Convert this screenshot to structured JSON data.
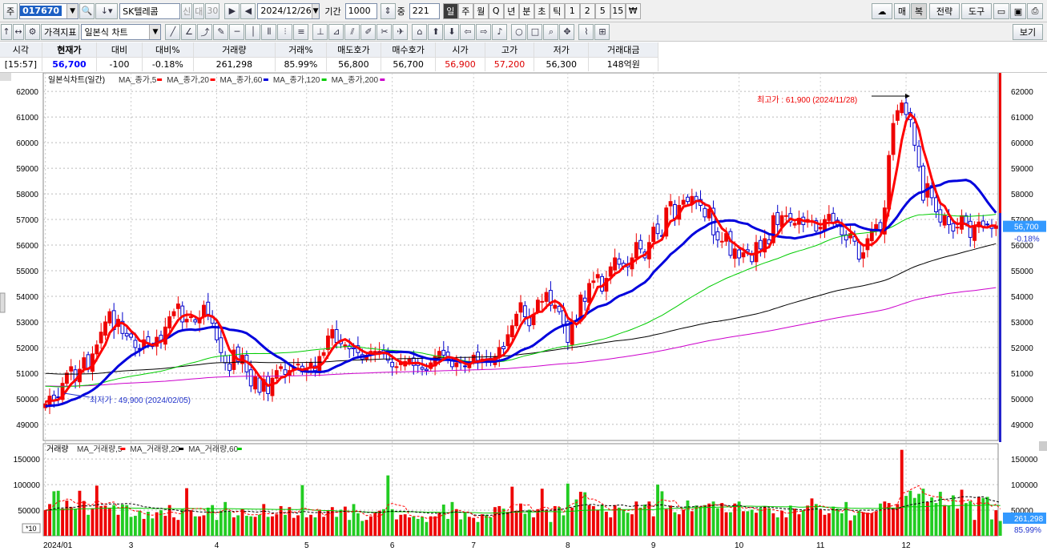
{
  "toolbar": {
    "mode_label": "주",
    "stock_code": "017670",
    "stock_name": "SK텔레콤",
    "market_btns": [
      "신",
      "대",
      "30"
    ],
    "date": "2024/12/26",
    "period_label": "기간",
    "period_value": "1000",
    "count_label": "중",
    "count_value": "221",
    "timeframes": [
      "일",
      "주",
      "월",
      "Q",
      "년",
      "분",
      "초",
      "틱",
      "1",
      "2",
      "5",
      "15",
      "₩"
    ],
    "active_timeframe": "일",
    "right_buttons": [
      "매",
      "복",
      "전략",
      "도구"
    ]
  },
  "toolbar2": {
    "indicator_btn": "가격지표",
    "chart_type": "일본식 차트",
    "view_btn": "보기"
  },
  "quote": {
    "headers": [
      "시각",
      "현재가",
      "대비",
      "대비%",
      "거래량",
      "거래%",
      "매도호가",
      "매수호가",
      "시가",
      "고가",
      "저가",
      "거래대금"
    ],
    "values": [
      "[15:57]",
      "56,700",
      "-100",
      "-0.18%",
      "261,298",
      "85.99%",
      "56,800",
      "56,700",
      "56,900",
      "57,200",
      "56,300",
      "148억원"
    ]
  },
  "chart_data": [
    {
      "type": "candlestick",
      "title": "일본식차트(일간)",
      "legend": [
        {
          "name": "MA_종가,5",
          "color": "#ff0000"
        },
        {
          "name": "MA_종가,20",
          "color": "#ff0000"
        },
        {
          "name": "MA_종가,60",
          "color": "#0000dd"
        },
        {
          "name": "MA_종가,120",
          "color": "#00cc00"
        },
        {
          "name": "MA_종가,200",
          "color": "#cc00cc"
        }
      ],
      "ylim": [
        48400,
        62600
      ],
      "y_ticks": [
        49000,
        50000,
        51000,
        52000,
        53000,
        54000,
        55000,
        56000,
        57000,
        58000,
        59000,
        60000,
        61000,
        62000
      ],
      "x_ticks": [
        "2024/01",
        "3",
        "4",
        "5",
        "6",
        "7",
        "8",
        "9",
        "10",
        "11",
        "12"
      ],
      "x_tick_index": [
        0,
        20,
        40,
        61,
        81,
        100,
        122,
        142,
        162,
        181,
        201
      ],
      "closes": [
        49800,
        50100,
        49950,
        50050,
        50600,
        51000,
        51250,
        50700,
        51150,
        51600,
        51150,
        51750,
        52100,
        52600,
        53000,
        53400,
        52700,
        53100,
        52550,
        52450,
        52400,
        52000,
        51950,
        52300,
        52150,
        52050,
        52400,
        52250,
        52800,
        53200,
        53400,
        53700,
        53000,
        53100,
        53200,
        53000,
        53150,
        53650,
        53300,
        52950,
        52300,
        51800,
        51400,
        51100,
        51900,
        51450,
        51700,
        51050,
        50500,
        50850,
        50250,
        50750,
        50200,
        50800,
        51100,
        51250,
        50950,
        51100,
        51200,
        51350,
        51050,
        51150,
        51400,
        51100,
        51650,
        51800,
        52450,
        52700,
        52200,
        52150,
        52100,
        51950,
        51950,
        51800,
        51550,
        51700,
        51850,
        51850,
        51850,
        51750,
        51500,
        51250,
        51250,
        51400,
        51450,
        51550,
        51300,
        51300,
        51150,
        51100,
        51400,
        51650,
        51850,
        51700,
        51550,
        51250,
        51400,
        51400,
        51250,
        51400,
        51700,
        51500,
        51550,
        51500,
        51450,
        51650,
        52000,
        51950,
        52500,
        52850,
        53300,
        53750,
        53200,
        52850,
        53300,
        53850,
        53800,
        54150,
        53650,
        53650,
        53400,
        52900,
        52200,
        53050,
        52950,
        54050,
        53800,
        54500,
        54600,
        54850,
        54200,
        54700,
        55150,
        55500,
        55250,
        55150,
        55150,
        55500,
        56100,
        55850,
        55500,
        56100,
        56700,
        56450,
        56350,
        57450,
        57700,
        57050,
        57550,
        57750,
        57700,
        57900,
        57700,
        57550,
        57100,
        57400,
        56400,
        56200,
        56150,
        56450,
        55600,
        55850,
        55500,
        55700,
        55750,
        55350,
        56100,
        55850,
        56250,
        56050,
        57150,
        56800,
        57150,
        57150,
        56900,
        56850,
        57050,
        56800,
        57000,
        56950,
        56550,
        56700,
        57000,
        57200,
        56850,
        56800,
        56400,
        56200,
        56450,
        56150,
        55450,
        55700,
        56250,
        56550,
        56800,
        56550,
        57450,
        59500,
        60750,
        61250,
        61550,
        61100,
        60900,
        59900,
        59050,
        57750,
        58400,
        57850,
        57300,
        56900,
        57150,
        56800,
        56550,
        56700,
        57150,
        56850,
        56300,
        56750,
        56900,
        56700,
        56800,
        56650,
        56750
      ]
    },
    {
      "type": "bar",
      "title": "거래량",
      "legend": [
        {
          "name": "MA_거래량,5",
          "color": "#ff0000"
        },
        {
          "name": "MA_거래량,20",
          "color": "#000000"
        },
        {
          "name": "MA_거래량,60",
          "color": "#00cc00"
        }
      ],
      "ylim": [
        0,
        180000
      ],
      "y_ticks": [
        50000,
        100000,
        150000
      ],
      "y_tick_labels": [
        "50000",
        "100000",
        "150000"
      ],
      "unit_badge": "*10",
      "last_volume": "261,298",
      "last_ratio": "85.99%",
      "values": [
        50000,
        62000,
        87000,
        88000,
        53000,
        69000,
        56000,
        53000,
        88000,
        68000,
        41000,
        54000,
        98000,
        58000,
        59000,
        55000,
        60000,
        41000,
        61000,
        60000,
        37000,
        39000,
        49000,
        33000,
        47000,
        34000,
        46000,
        50000,
        39000,
        60000,
        36000,
        31000,
        52000,
        93000,
        50000,
        38000,
        38000,
        40000,
        55000,
        60000,
        31000,
        49000,
        66000,
        47000,
        36000,
        40000,
        52000,
        39000,
        38000,
        37000,
        41000,
        62000,
        37000,
        38000,
        42000,
        58000,
        41000,
        56000,
        35000,
        40000,
        99000,
        36000,
        41000,
        36000,
        49000,
        37000,
        50000,
        56000,
        37000,
        51000,
        57000,
        31000,
        62000,
        44000,
        29000,
        31000,
        38000,
        45000,
        49000,
        52000,
        118000,
        52000,
        32000,
        41000,
        42000,
        36000,
        38000,
        33000,
        37000,
        27000,
        38000,
        38000,
        45000,
        61000,
        33000,
        66000,
        52000,
        32000,
        46000,
        37000,
        35000,
        27000,
        42000,
        41000,
        36000,
        56000,
        58000,
        53000,
        47000,
        96000,
        49000,
        63000,
        43000,
        51000,
        36000,
        52000,
        92000,
        50000,
        27000,
        58000,
        56000,
        40000,
        102000,
        55000,
        71000,
        86000,
        85000,
        60000,
        58000,
        51000,
        61000,
        47000,
        36000,
        60000,
        55000,
        51000,
        45000,
        42000,
        67000,
        55000,
        61000,
        67000,
        38000,
        100000,
        87000,
        52000,
        59000,
        46000,
        42000,
        51000,
        69000,
        48000,
        59000,
        57000,
        60000,
        63000,
        67000,
        54000,
        64000,
        46000,
        46000,
        63000,
        67000,
        48000,
        48000,
        51000,
        45000,
        54000,
        58000,
        54000,
        44000,
        36000,
        49000,
        36000,
        59000,
        53000,
        42000,
        50000,
        59000,
        73000,
        62000,
        51000,
        41000,
        44000,
        57000,
        53000,
        44000,
        66000,
        30000,
        40000,
        49000,
        46000,
        45000,
        44000,
        48000,
        63000,
        67000,
        64000,
        54000,
        62000,
        168000,
        78000,
        88000,
        74000,
        82000,
        92000,
        66000,
        75000,
        64000,
        86000,
        60000,
        58000,
        79000,
        53000,
        90000,
        64000,
        68000,
        31000,
        76000,
        74000,
        76000,
        32000,
        50000,
        29000
      ]
    }
  ],
  "annotations": {
    "high": "최고가 : 61,900 (2024/11/28)",
    "low": "최저가 : 49,900 (2024/02/05)"
  },
  "price_badge": {
    "price": "56,700",
    "change": "-0.18%"
  }
}
